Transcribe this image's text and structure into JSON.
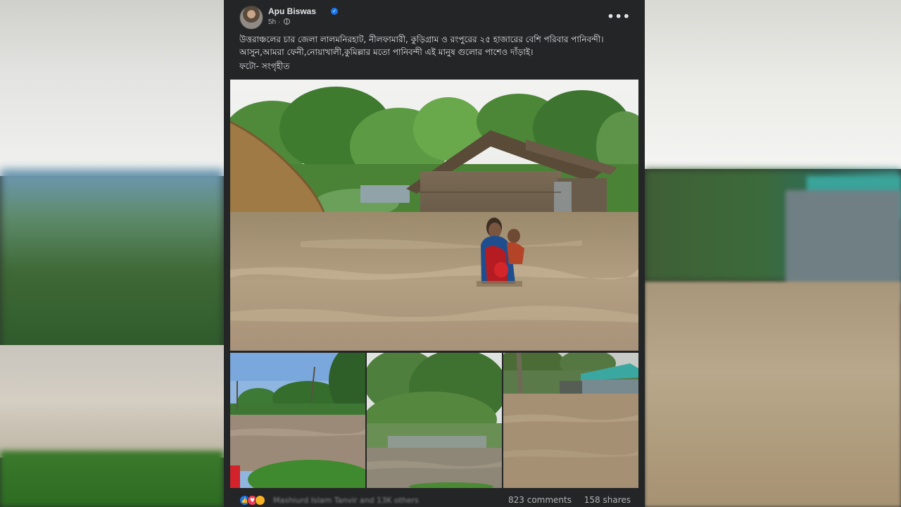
{
  "post": {
    "author": "Apu Biswas",
    "time": "5h",
    "text_line_1": "উত্তরাঞ্চলের চার জেলা লালমনিরহাট, নীলফামারী, কুড়িগ্রাম ও রংপুরের ২৫ হাজারের বেশি পরিবার পানিবন্দী।",
    "text_line_2": "আসুন,আমরা ফেনী,নোয়াখালী,কুমিল্লার মতো পানিবন্দী এই মানুষ গুলোর পাশেও দাঁড়াই।",
    "credit": "ফটো- সংগৃহীত",
    "more_label": "•••",
    "verified_glyph": "✓"
  },
  "footer": {
    "reaction_names": "Mashiurd Islam Tanvir and 13K others",
    "comments": "823 comments",
    "shares": "158 shares",
    "reaction_icons": [
      "like-icon",
      "love-icon",
      "care-icon"
    ]
  },
  "colors": {
    "card_bg": "#242526",
    "text": "#e4e6eb",
    "muted": "#b0b3b8",
    "verified": "#1877f2"
  }
}
